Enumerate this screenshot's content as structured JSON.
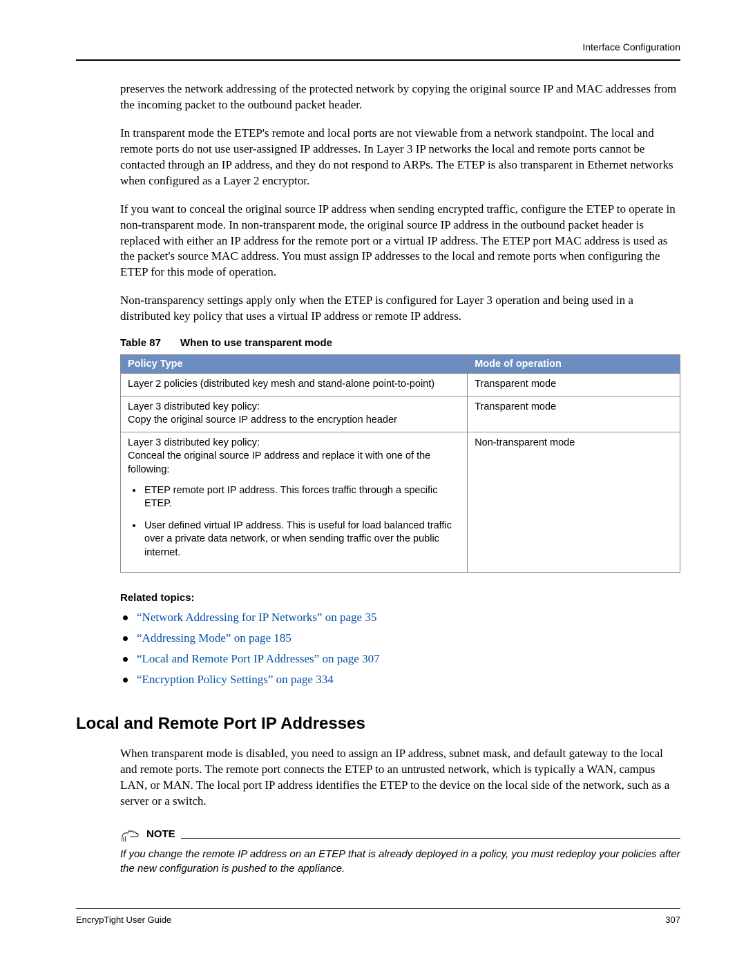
{
  "header": {
    "section": "Interface Configuration"
  },
  "paragraphs": {
    "p1": "preserves the network addressing of the protected network by copying the original source IP and MAC addresses from the incoming packet to the outbound packet header.",
    "p2": "In transparent mode the ETEP's remote and local ports are not viewable from a network standpoint. The local and remote ports do not use user-assigned IP addresses. In Layer 3 IP networks the local and remote ports cannot be contacted through an IP address, and they do not respond to ARPs. The ETEP is also transparent in Ethernet networks when configured as a Layer 2 encryptor.",
    "p3": "If you want to conceal the original source IP address when sending encrypted traffic, configure the ETEP to operate in non-transparent mode. In non-transparent mode, the original source IP address in the outbound packet header is replaced with either an IP address for the remote port or a virtual IP address. The ETEP port MAC address is used as the packet's source MAC address. You must assign IP addresses to the local and remote ports when configuring the ETEP for this mode of operation.",
    "p4": "Non-transparency settings apply only when the ETEP is configured for Layer 3 operation and being used in a distributed key policy that uses a virtual IP address or remote IP address."
  },
  "table": {
    "caption_prefix": "Table 87",
    "caption_title": "When to use transparent mode",
    "headers": {
      "policy": "Policy Type",
      "mode": "Mode of operation"
    },
    "rows": [
      {
        "policy": "Layer 2 policies (distributed key mesh and stand-alone point-to-point)",
        "mode": "Transparent mode"
      },
      {
        "policy": "Layer 3 distributed key policy:\nCopy the original source IP address to the encryption header",
        "mode": "Transparent mode"
      }
    ],
    "row3": {
      "policy_intro": "Layer 3 distributed key policy:\nConceal the original source IP address and replace it with one of the following:",
      "bullets": [
        "ETEP remote port IP address. This forces traffic through a specific ETEP.",
        "User defined virtual IP address. This is useful for load balanced traffic over a private data network, or when sending traffic over the public internet."
      ],
      "mode": "Non-transparent mode"
    }
  },
  "related": {
    "heading": "Related topics:",
    "items": [
      "“Network Addressing for IP Networks” on page 35",
      "“Addressing Mode” on page 185",
      "“Local and Remote Port IP Addresses” on page 307",
      "“Encryption Policy Settings” on page 334"
    ]
  },
  "section": {
    "title": "Local and Remote Port IP Addresses",
    "p1": "When transparent mode is disabled, you need to assign an IP address, subnet mask, and default gateway to the local and remote ports. The remote port connects the ETEP to an untrusted network, which is typically a WAN, campus LAN, or MAN. The local port IP address identifies the ETEP to the device on the local side of the network, such as a server or a switch."
  },
  "note": {
    "label": "NOTE",
    "text": "If you change the remote IP address on an ETEP that is already deployed in a policy, you must redeploy your policies after the new configuration is pushed to the appliance."
  },
  "footer": {
    "left": "EncrypTight User Guide",
    "right": "307"
  }
}
